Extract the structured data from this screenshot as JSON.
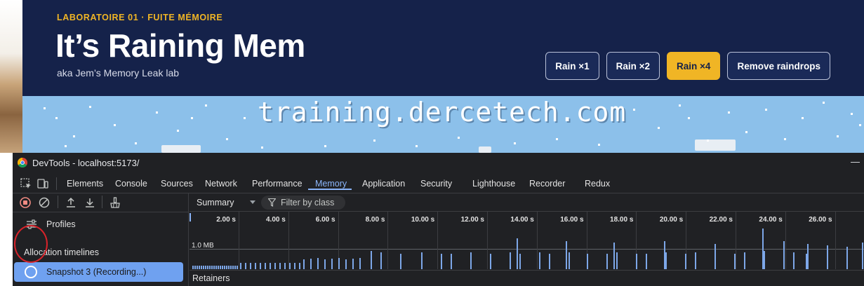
{
  "page": {
    "kicker": "LABORATOIRE 01 · FUITE MÉMOIRE",
    "title": "It’s Raining Mem",
    "subtitle": "aka Jem’s Memory Leak lab",
    "buttons": [
      {
        "label": "Rain ×1",
        "active": false
      },
      {
        "label": "Rain ×2",
        "active": false
      },
      {
        "label": "Rain ×4",
        "active": true
      },
      {
        "label": "Remove raindrops",
        "active": false
      }
    ],
    "watermark": "training.dercetech.com",
    "colors": {
      "header_bg": "#15224a",
      "accent": "#f0b525",
      "sky": "#8cc0ea"
    }
  },
  "devtools": {
    "window_title": "DevTools - localhost:5173/",
    "tabs": [
      "Elements",
      "Console",
      "Sources",
      "Network",
      "Performance",
      "Memory",
      "Application",
      "Security",
      "Lighthouse",
      "Recorder",
      "Redux"
    ],
    "active_tab": "Memory",
    "toolbar_icons": [
      "record-stop-icon",
      "clear-icon",
      "upload-icon",
      "download-icon",
      "garbage-collect-icon"
    ],
    "sidebar": {
      "profiles_label": "Profiles",
      "section_label": "Allocation timelines",
      "snapshot_label": "Snapshot 3 (Recording...)"
    },
    "view_select": "Summary",
    "filter_placeholder": "Filter by class",
    "timeline": {
      "tick_labels": [
        "2.00 s",
        "4.00 s",
        "6.00 s",
        "8.00 s",
        "10.00 s",
        "12.00 s",
        "14.00 s",
        "16.00 s",
        "18.00 s",
        "20.00 s",
        "22.00 s",
        "24.00 s",
        "26.00 s"
      ],
      "memory_label": "1.0 MB"
    },
    "retainers_label": "Retainers"
  }
}
